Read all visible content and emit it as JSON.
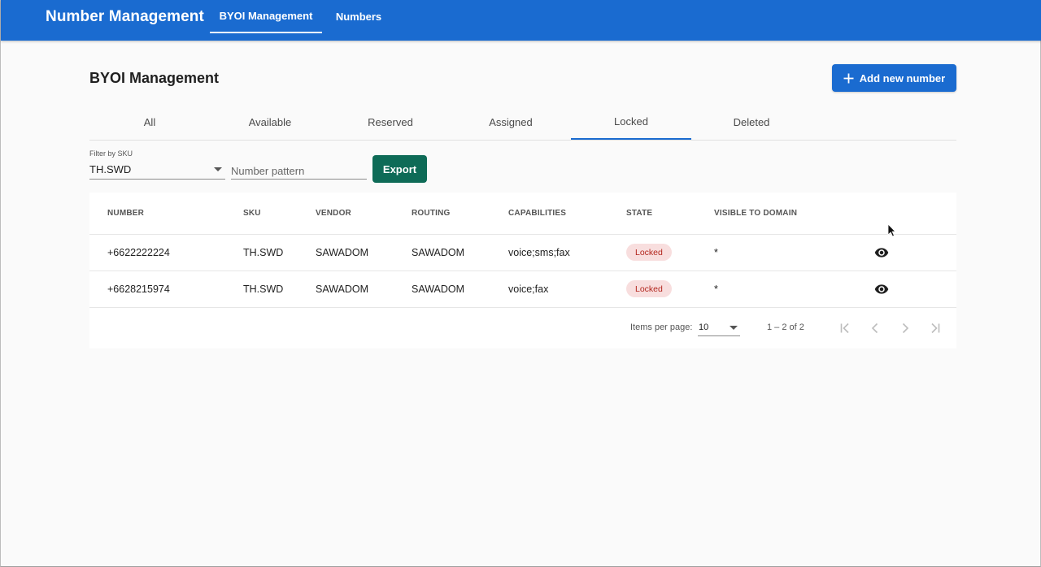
{
  "app": {
    "title": "Number Management",
    "nav": [
      {
        "label": "BYOI Management",
        "active": true
      },
      {
        "label": "Numbers",
        "active": false
      }
    ]
  },
  "page": {
    "title": "BYOI Management",
    "add_button": {
      "label": "Add new number",
      "icon": "plus-icon"
    }
  },
  "state_tabs": [
    {
      "label": "All",
      "active": false
    },
    {
      "label": "Available",
      "active": false
    },
    {
      "label": "Reserved",
      "active": false
    },
    {
      "label": "Assigned",
      "active": false
    },
    {
      "label": "Locked",
      "active": true
    },
    {
      "label": "Deleted",
      "active": false
    }
  ],
  "filters": {
    "sku_label": "Filter by SKU",
    "sku_value": "TH.SWD",
    "pattern_placeholder": "Number pattern",
    "pattern_value": "",
    "export_label": "Export"
  },
  "table": {
    "columns": [
      "NUMBER",
      "SKU",
      "VENDOR",
      "ROUTING",
      "CAPABILITIES",
      "STATE",
      "VISIBLE TO DOMAIN"
    ],
    "rows": [
      {
        "number": "+6622222224",
        "sku": "TH.SWD",
        "vendor": "SAWADOM",
        "routing": "SAWADOM",
        "capabilities": "voice;sms;fax",
        "state": "Locked",
        "visible": "*",
        "action_icon": "eye-icon"
      },
      {
        "number": "+6628215974",
        "sku": "TH.SWD",
        "vendor": "SAWADOM",
        "routing": "SAWADOM",
        "capabilities": "voice;fax",
        "state": "Locked",
        "visible": "*",
        "action_icon": "eye-icon"
      }
    ]
  },
  "pagination": {
    "items_per_page_label": "Items per page:",
    "items_per_page": "10",
    "range_label": "1 – 2 of 2",
    "icons": [
      "first-page-icon",
      "prev-page-icon",
      "next-page-icon",
      "last-page-icon"
    ]
  },
  "colors": {
    "primary": "#1a6bd0",
    "export": "#0e6b57",
    "badge_bg": "#f8dede",
    "badge_text": "#b3261e",
    "background": "#fafafa"
  }
}
